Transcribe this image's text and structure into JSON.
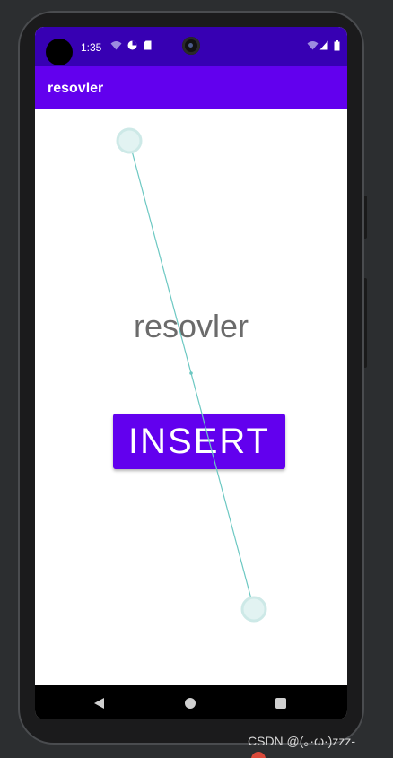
{
  "status_bar": {
    "time": "1:35",
    "icons": [
      "wifi-icon",
      "data-saver-icon",
      "sd-card-icon",
      "wifi-signal-icon",
      "cell-signal-icon",
      "battery-icon"
    ],
    "background": "#3700b3"
  },
  "app_bar": {
    "title": "resovler",
    "background": "#6200ee"
  },
  "main": {
    "label": "resovler",
    "button_label": "INSERT",
    "button_color": "#6200ee"
  },
  "nav_bar": {
    "icons": [
      "back-icon",
      "home-icon",
      "recents-icon"
    ]
  },
  "watermark": {
    "text": "CSDN @(。·ω·)zzz-"
  }
}
